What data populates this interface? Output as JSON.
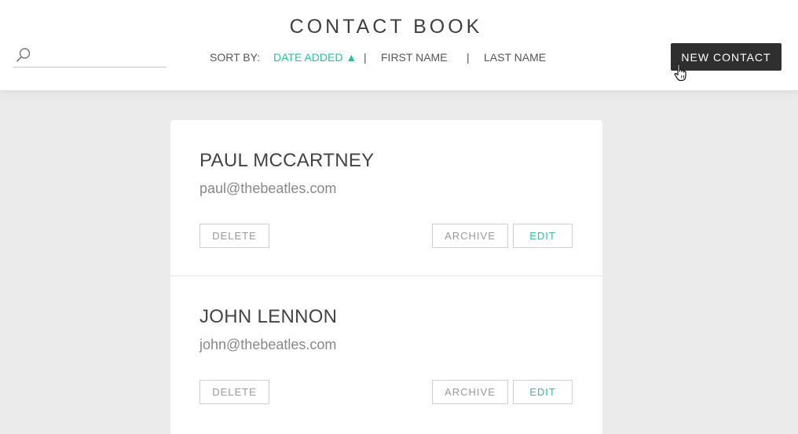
{
  "header": {
    "title": "CONTACT BOOK",
    "search": {
      "placeholder": "",
      "value": ""
    },
    "sort": {
      "label": "SORT BY:",
      "options": [
        {
          "label": "DATE ADDED ▲",
          "active": true
        },
        {
          "label": "FIRST NAME",
          "active": false
        },
        {
          "label": "LAST NAME",
          "active": false
        }
      ],
      "separator": "|"
    },
    "new_contact_label": "NEW CONTACT"
  },
  "contacts": [
    {
      "name": "PAUL MCCARTNEY",
      "email": "paul@thebeatles.com",
      "delete_label": "DELETE",
      "archive_label": "ARCHIVE",
      "edit_label": "EDIT"
    },
    {
      "name": "JOHN LENNON",
      "email": "john@thebeatles.com",
      "delete_label": "DELETE",
      "archive_label": "ARCHIVE",
      "edit_label": "EDIT"
    }
  ],
  "colors": {
    "accent": "#2bbf9f",
    "header_bg": "#ffffff",
    "page_bg": "#ebebeb",
    "button_dark": "#2f2f2f"
  },
  "icons": {
    "search": "search-icon",
    "cursor": "hand-pointer-icon"
  }
}
